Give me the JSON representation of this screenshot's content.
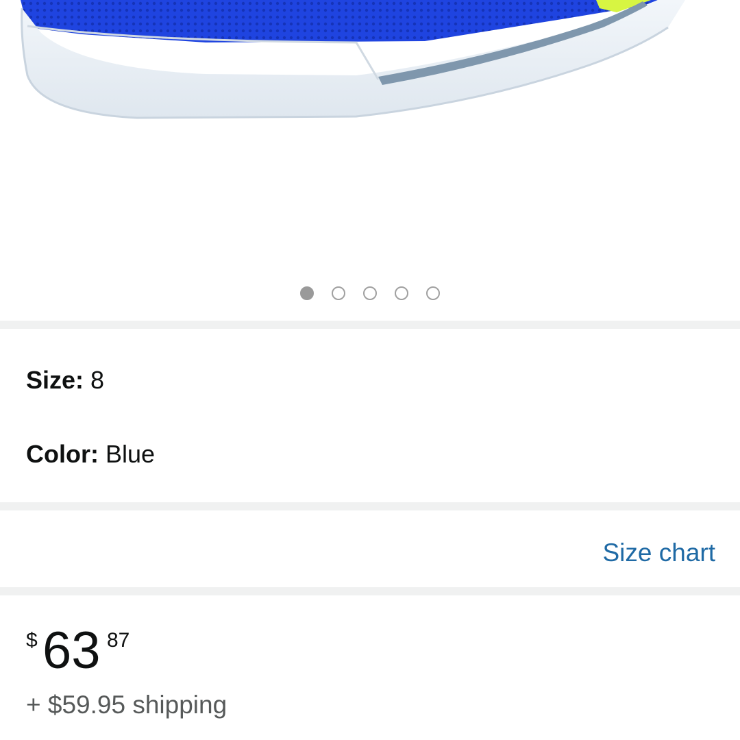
{
  "product_image": {
    "alt_icon": "shoe-image",
    "carousel_total": 5,
    "carousel_active_index": 0
  },
  "variations": {
    "size_label": "Size:",
    "size_value": "8",
    "color_label": "Color:",
    "color_value": "Blue"
  },
  "size_chart_link": "Size chart",
  "price": {
    "symbol": "$",
    "whole": "63",
    "fraction": "87"
  },
  "shipping": "+ $59.95 shipping",
  "colors": {
    "link": "#1f6aa5",
    "separator": "#f0f1f1",
    "shoe_upper": "#1f44e0",
    "sole": "#e6edf5",
    "sole_stripe": "#7f97ad"
  }
}
